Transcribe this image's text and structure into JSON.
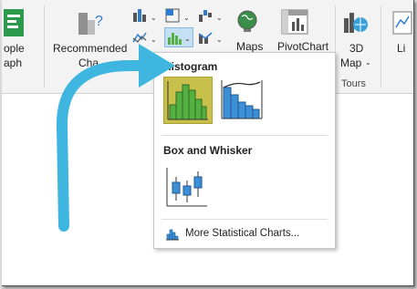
{
  "ribbon": {
    "people_graph_label_1": "ople",
    "people_graph_label_2": "aph",
    "recommended_label_1": "Recommended",
    "recommended_label_2": "Cha",
    "maps_label": "Maps",
    "pivotchart_label": "PivotChart",
    "map3d_label_1": "3D",
    "map3d_label_2": "Map",
    "tours_group_label": "Tours",
    "cut_label": "Li"
  },
  "dropdown": {
    "histogram_header": "Histogram",
    "box_whisker_header": "Box and Whisker",
    "more_label": "More Statistical Charts...",
    "charts": [
      "histogram-chart",
      "pareto-chart",
      "box-and-whisker-chart"
    ]
  },
  "colors": {
    "selected_tile": "#c8c04a",
    "bar_green": "#54b141",
    "bar_blue": "#3d8fd6",
    "arrow": "#3fb6e0"
  }
}
